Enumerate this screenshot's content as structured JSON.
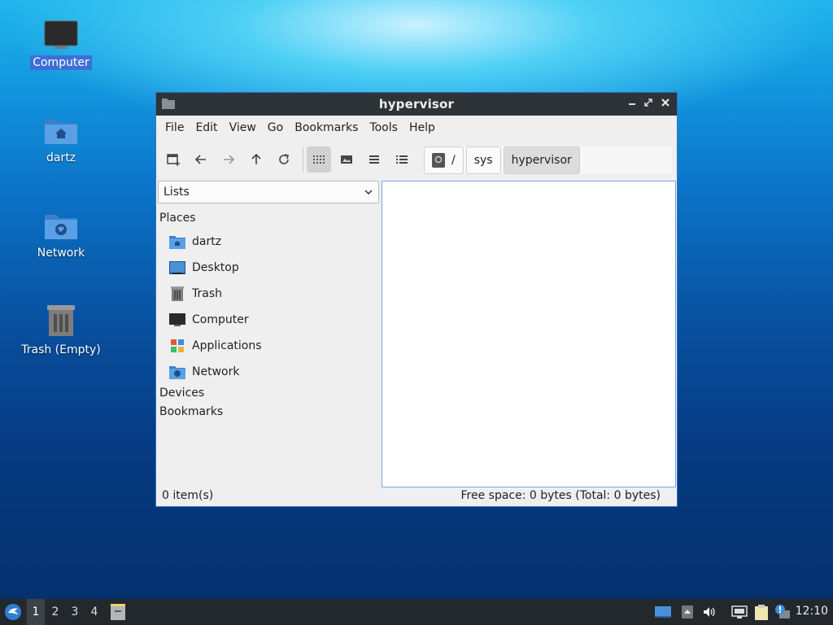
{
  "desktop": {
    "icons": [
      {
        "label": "Computer",
        "icon": "computer-icon",
        "selected": true
      },
      {
        "label": "dartz",
        "icon": "home-folder-icon"
      },
      {
        "label": "Network",
        "icon": "network-folder-icon"
      },
      {
        "label": "Trash (Empty)",
        "icon": "trash-icon"
      }
    ]
  },
  "window": {
    "title": "hypervisor",
    "menu": [
      "File",
      "Edit",
      "View",
      "Go",
      "Bookmarks",
      "Tools",
      "Help"
    ],
    "toolbar_icons": [
      "new-tab-icon",
      "back-icon",
      "forward-icon",
      "up-icon",
      "reload-icon",
      "icon-view-icon",
      "thumbnail-view-icon",
      "compact-view-icon",
      "detailed-list-view-icon"
    ],
    "path": [
      "/",
      "sys",
      "hypervisor"
    ],
    "sidebar": {
      "mode": "Lists",
      "sections": {
        "places": "Places",
        "devices": "Devices",
        "bookmarks": "Bookmarks"
      },
      "places": [
        {
          "label": "dartz",
          "icon": "home-folder-icon"
        },
        {
          "label": "Desktop",
          "icon": "desktop-icon"
        },
        {
          "label": "Trash",
          "icon": "trash-icon"
        },
        {
          "label": "Computer",
          "icon": "computer-icon"
        },
        {
          "label": "Applications",
          "icon": "applications-icon"
        },
        {
          "label": "Network",
          "icon": "network-folder-icon"
        }
      ]
    },
    "status": {
      "items": "0 item(s)",
      "free_space": "Free space: 0 bytes (Total: 0 bytes)"
    }
  },
  "taskbar": {
    "workspaces": [
      "1",
      "2",
      "3",
      "4"
    ],
    "active_workspace": "1",
    "clock": "12:10"
  },
  "colors": {
    "accent": "#3d6fd6",
    "titlebar": "#2e3338",
    "taskbar": "#23282d",
    "folder": "#4a90d9"
  }
}
